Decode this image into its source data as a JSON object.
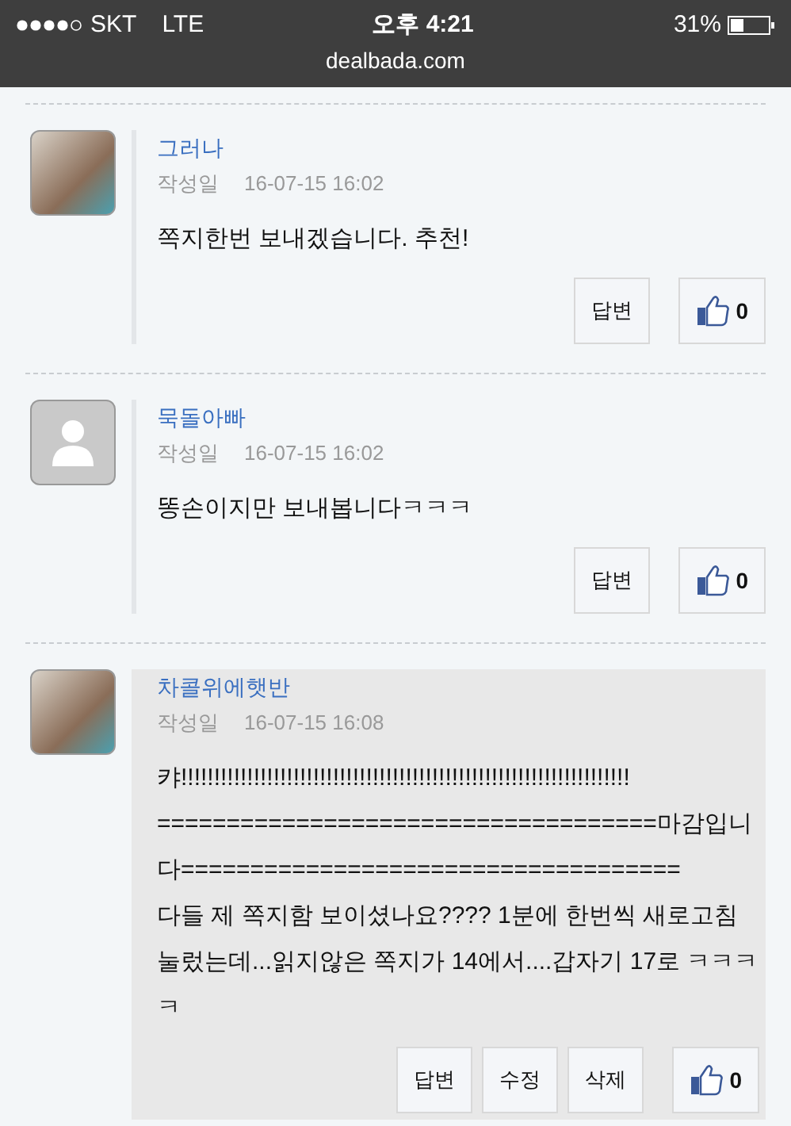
{
  "status_bar": {
    "carrier": "SKT",
    "network": "LTE",
    "time": "오후 4:21",
    "battery": "31%",
    "url": "dealbada.com"
  },
  "comments": [
    {
      "author": "그러나",
      "date_label": "작성일",
      "date": "16-07-15 16:02",
      "body": "쪽지한번 보내겠습니다. 추천!",
      "own": false,
      "avatar": {
        "kind": "photo"
      },
      "buttons": [
        "답변"
      ],
      "likes": "0"
    },
    {
      "author": "묵돌아빠",
      "date_label": "작성일",
      "date": "16-07-15 16:02",
      "body": "똥손이지만 보내봅니다ㅋㅋㅋ",
      "own": false,
      "avatar": {
        "kind": "default"
      },
      "buttons": [
        "답변"
      ],
      "likes": "0"
    },
    {
      "author": "차콜위에햇반",
      "date_label": "작성일",
      "date": "16-07-15 16:08",
      "body": "캬!!!!!!!!!!!!!!!!!!!!!!!!!!!!!!!!!!!!!!!!!!!!!!!!!!!!!!!!!!!!!!!!!!!!\n====================================마감입니다====================================\n다들 제 쪽지함 보이셨나요???? 1분에 한번씩 새로고침 눌렀는데...읽지않은 쪽지가 14에서....갑자기 17로 ㅋㅋㅋㅋ",
      "own": true,
      "avatar": {
        "kind": "photo"
      },
      "buttons": [
        "답변",
        "수정",
        "삭제"
      ],
      "likes": "0"
    }
  ]
}
